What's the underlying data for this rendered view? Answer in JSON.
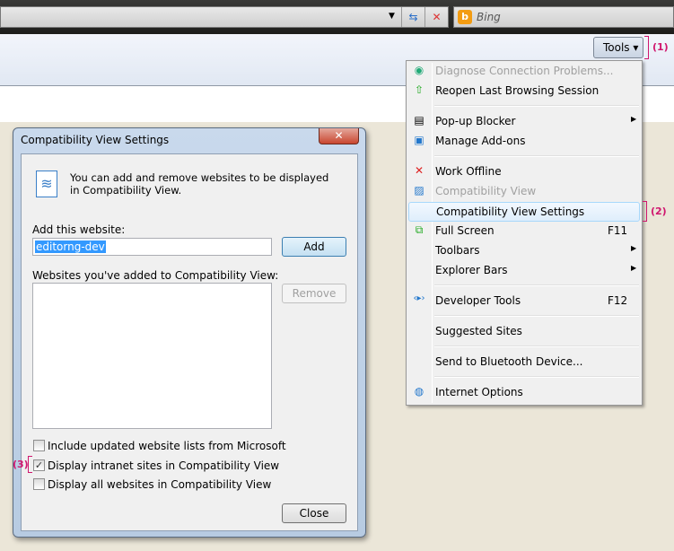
{
  "browser": {
    "search_provider": "Bing",
    "tools_label": "Tools",
    "tools_arrow": "▾",
    "refresh_icon": "refresh-icon",
    "stop_icon": "stop-icon"
  },
  "annotations": {
    "one": "(1)",
    "two": "(2)",
    "three": "(3)"
  },
  "menu": {
    "diagnose": "Diagnose Connection Problems...",
    "reopen": "Reopen Last Browsing Session",
    "popup": "Pop-up Blocker",
    "addons": "Manage Add-ons",
    "offline": "Work Offline",
    "compat": "Compatibility View",
    "compat_settings": "Compatibility View Settings",
    "fullscreen": "Full Screen",
    "fullscreen_key": "F11",
    "toolbars": "Toolbars",
    "explorer_bars": "Explorer Bars",
    "devtools": "Developer Tools",
    "devtools_key": "F12",
    "suggested": "Suggested Sites",
    "bluetooth": "Send to Bluetooth Device...",
    "options": "Internet Options",
    "submenu_arrow": "▶"
  },
  "dialog": {
    "title": "Compatibility View Settings",
    "close_glyph": "✕",
    "description": "You can add and remove websites to be displayed in Compatibility View.",
    "add_label": "Add this website:",
    "add_value": "editorng-dev",
    "add_button": "Add",
    "list_label": "Websites you've added to Compatibility View:",
    "remove_button": "Remove",
    "checkboxes": [
      {
        "label": "Include updated website lists from Microsoft",
        "checked": false
      },
      {
        "label": "Display intranet sites in Compatibility View",
        "checked": true
      },
      {
        "label": "Display all websites in Compatibility View",
        "checked": false
      }
    ],
    "check_glyph": "✓",
    "close_button": "Close"
  }
}
